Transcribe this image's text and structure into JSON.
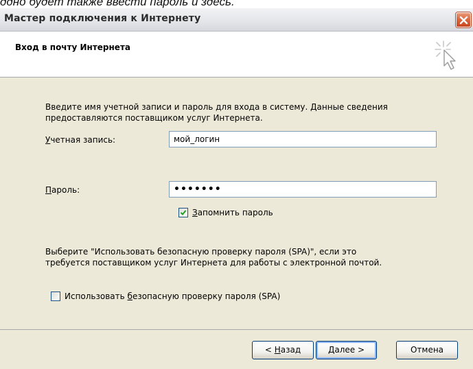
{
  "top_caption": "ддно будет также ввести пароль и здесь.",
  "window": {
    "title": "Мастер подключения к Интернету",
    "close_icon": "close-icon"
  },
  "header": {
    "title": "Вход в почту Интернета",
    "icon": "wizard-cursor-icon"
  },
  "content": {
    "intro_line1": "Введите имя учетной записи и пароль для входа в систему. Данные сведения",
    "intro_line2": "предоставляются поставщиком услуг Интернета.",
    "account": {
      "label_accel": "У",
      "label_rest": "четная запись:",
      "value": "мой_логин"
    },
    "password": {
      "label_accel": "П",
      "label_rest": "ароль:",
      "value": "•••••••"
    },
    "remember": {
      "checked": true,
      "label_accel": "З",
      "label_rest": "апомнить пароль"
    },
    "spa_note_line1": "Выберите \"Использовать безопасную проверку пароля (SPA)\", если это",
    "spa_note_line2": "требуется поставщиком услуг Интернета для работы с электронной почтой.",
    "spa_checkbox": {
      "checked": false,
      "label_before": "Использовать ",
      "label_accel": "б",
      "label_after": "езопасную проверку пароля (SPA)"
    }
  },
  "buttons": {
    "back_prefix": "< ",
    "back_accel": "Н",
    "back_rest": "азад",
    "next_accel": "Д",
    "next_rest": "алее >",
    "cancel": "Отмена"
  }
}
